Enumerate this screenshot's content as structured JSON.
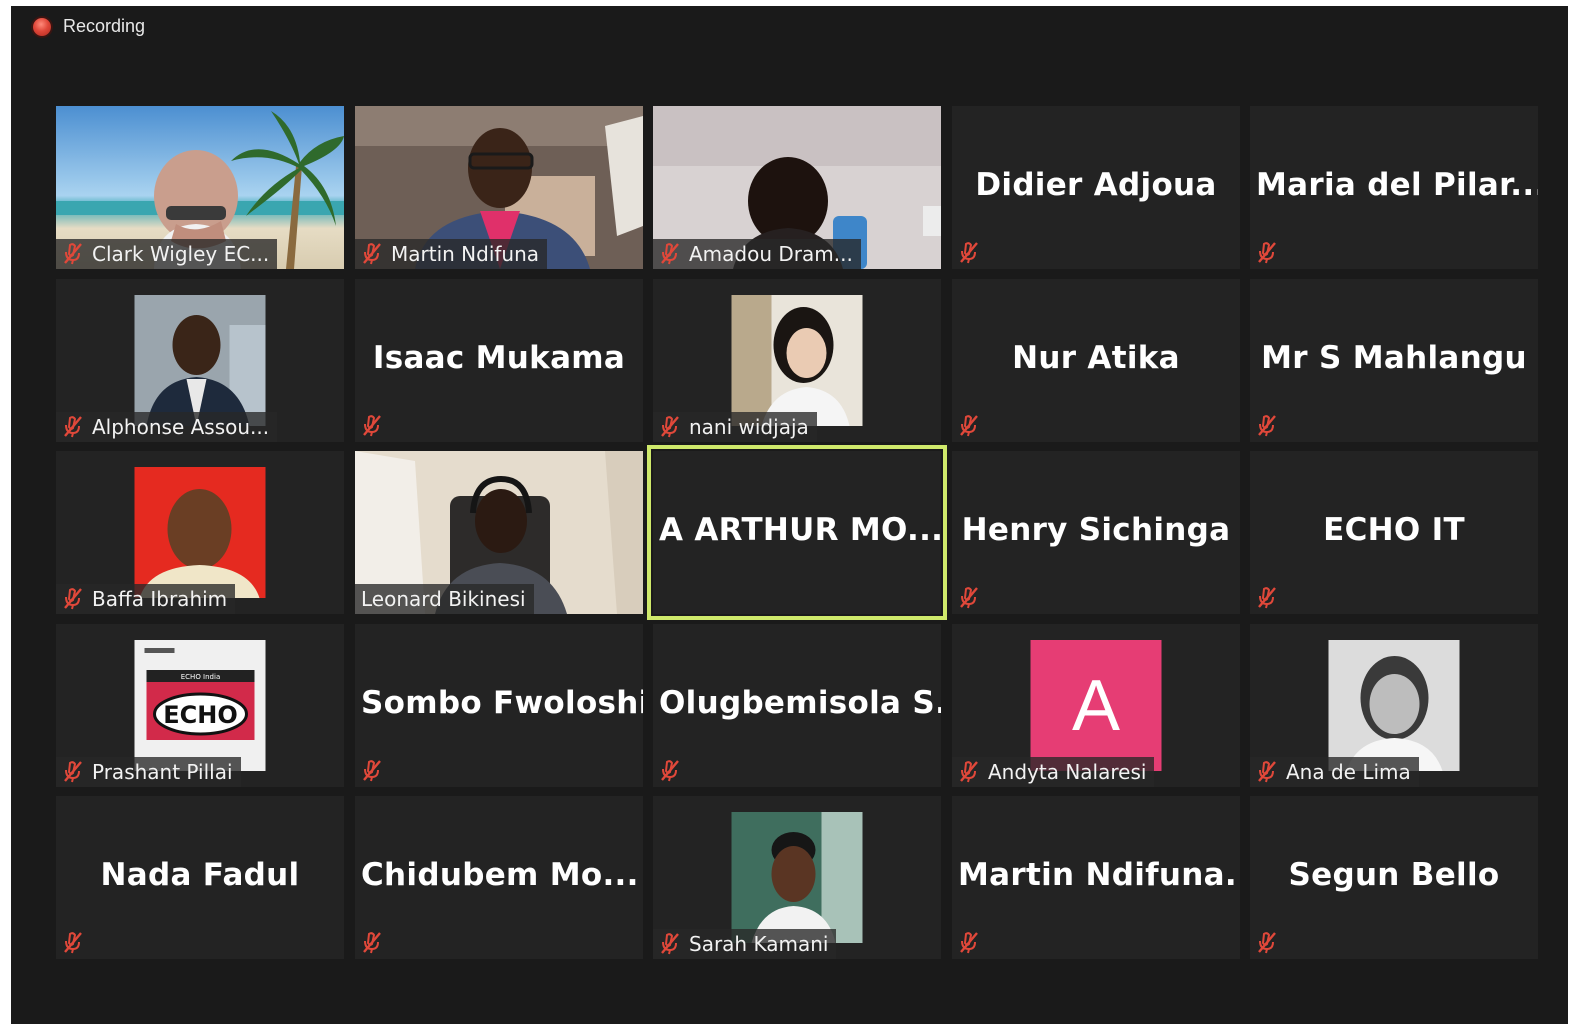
{
  "header": {
    "recording_label": "Recording"
  },
  "colors": {
    "background": "#1a1a1a",
    "tile": "#232323",
    "active_border": "#cfe96b",
    "mute_icon": "#e0483a",
    "avatar_pink": "#e63d74"
  },
  "participants": [
    {
      "name": "Clark Wigley EC...",
      "display": "video"
    },
    {
      "name": "Martin Ndifuna",
      "display": "video"
    },
    {
      "name": "Amadou Dram...",
      "display": "video"
    },
    {
      "name": "Didier Adjoua",
      "display": "name"
    },
    {
      "name": "Maria del Pilar...",
      "display": "name"
    },
    {
      "name": "Alphonse Assou...",
      "display": "photo"
    },
    {
      "name": "Isaac Mukama",
      "display": "name"
    },
    {
      "name": "nani widjaja",
      "display": "photo"
    },
    {
      "name": "Nur Atika",
      "display": "name"
    },
    {
      "name": "Mr S Mahlangu",
      "display": "name"
    },
    {
      "name": "Baffa Ibrahim",
      "display": "photo"
    },
    {
      "name": "Leonard Bikinesi",
      "display": "video"
    },
    {
      "name": "A ARTHUR MO...",
      "display": "name"
    },
    {
      "name": "Henry Sichinga",
      "display": "name"
    },
    {
      "name": "ECHO IT",
      "display": "name"
    },
    {
      "name": "Prashant Pillai",
      "display": "photo"
    },
    {
      "name": "Sombo Fwoloshi",
      "display": "name"
    },
    {
      "name": "Olugbemisola S...",
      "display": "name"
    },
    {
      "name": "Andyta Nalaresi",
      "display": "photo"
    },
    {
      "name": "Ana de Lima",
      "display": "photo"
    },
    {
      "name": "Nada Fadul",
      "display": "name"
    },
    {
      "name": "Chidubem Mo...",
      "display": "name"
    },
    {
      "name": "Sarah Kamani",
      "display": "photo"
    },
    {
      "name": "Martin Ndifuna...",
      "display": "name"
    },
    {
      "name": "Segun Bello",
      "display": "name"
    }
  ],
  "avatar_letter": "A",
  "echo_logo": {
    "header": "ECHO India",
    "mark": "ECHO"
  }
}
